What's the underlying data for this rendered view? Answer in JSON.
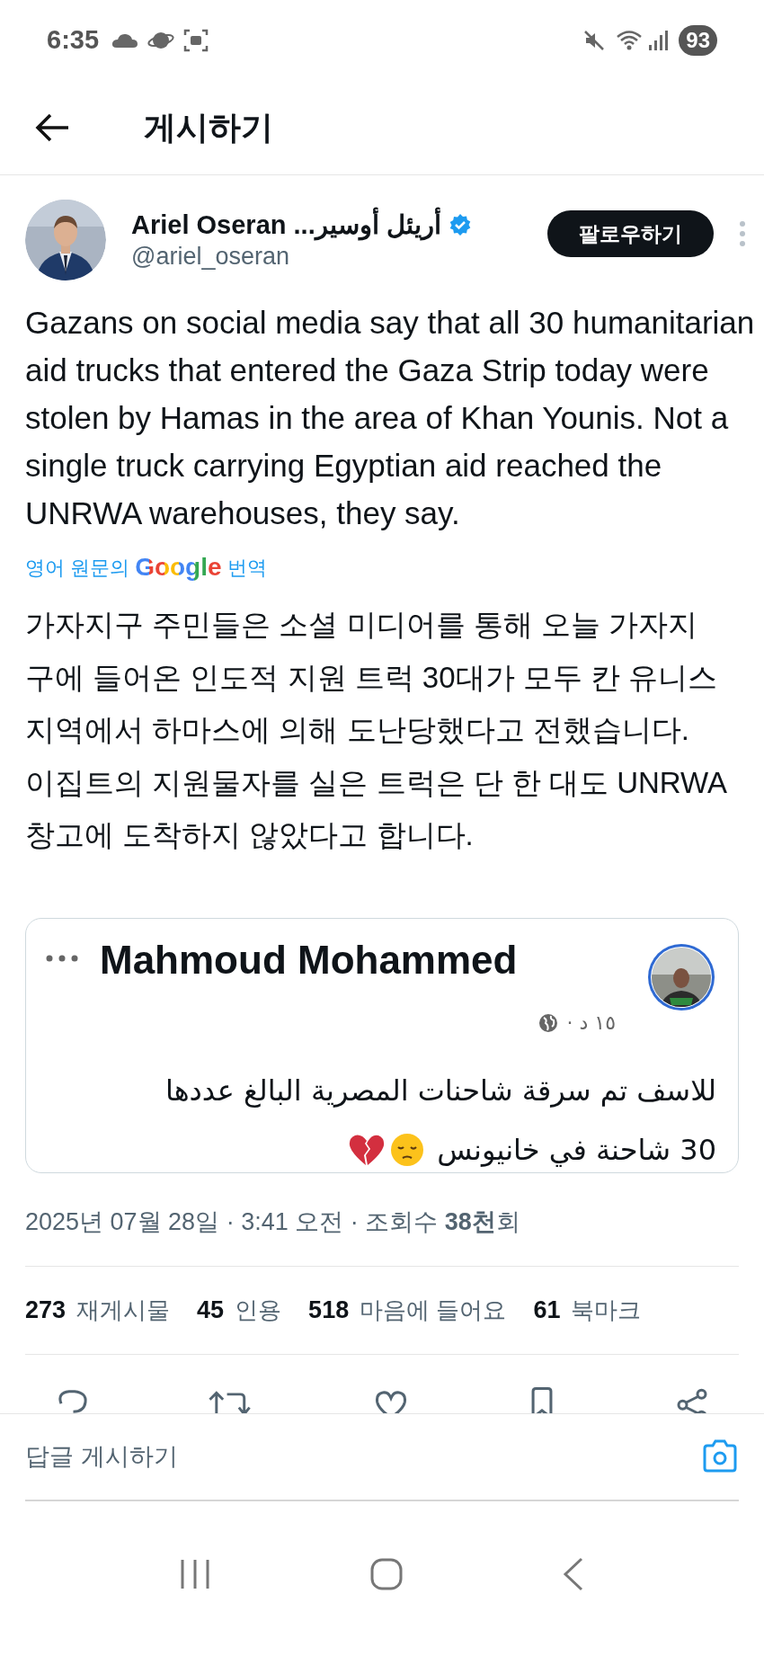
{
  "status_bar": {
    "time": "6:35",
    "battery": "93"
  },
  "header": {
    "title": "게시하기"
  },
  "post": {
    "author": {
      "name": "Ariel Oseran ...أريئل أوسير",
      "handle": "@ariel_oseran",
      "verified": true
    },
    "follow_button": "팔로우하기",
    "text": "Gazans on social media say that all 30 humanitarian aid trucks that entered the Gaza Strip today were stolen by Hamas in the area of Khan Younis. Not a single truck carrying Egyptian aid reached the UNRWA warehouses, they say.",
    "translation_note": {
      "before": "영어 원문의",
      "logo": "Google",
      "after": "번역"
    },
    "translation": "가자지구 주민들은 소셜 미디어를 통해 오늘 가자지구에 들어온 인도적 지원 트럭 30대가 모두 칸 유니스 지역에서 하마스에 의해 도난당했다고 전했습니다. 이집트의 지원물자를 실은 트럭은 단 한 대도 UNRWA 창고에 도착하지 않았다고 합니다.",
    "quoted": {
      "author": "Mahmoud Mohammed",
      "time": "١٥ د ·",
      "text_lines": [
        "للاسف تم سرقة شاحنات المصرية البالغ عددها",
        "30 شاحنة في خانيونس"
      ]
    },
    "timestamp": "2025년 07월 28일 · 3:41 오전 · 조회수 **38천**회",
    "stats": [
      {
        "count": "273",
        "label": "재게시물"
      },
      {
        "count": "45",
        "label": "인용"
      },
      {
        "count": "518",
        "label": "마음에 들어요"
      },
      {
        "count": "61",
        "label": "북마크"
      }
    ]
  },
  "reply_bar": {
    "placeholder": "답글 게시하기"
  }
}
